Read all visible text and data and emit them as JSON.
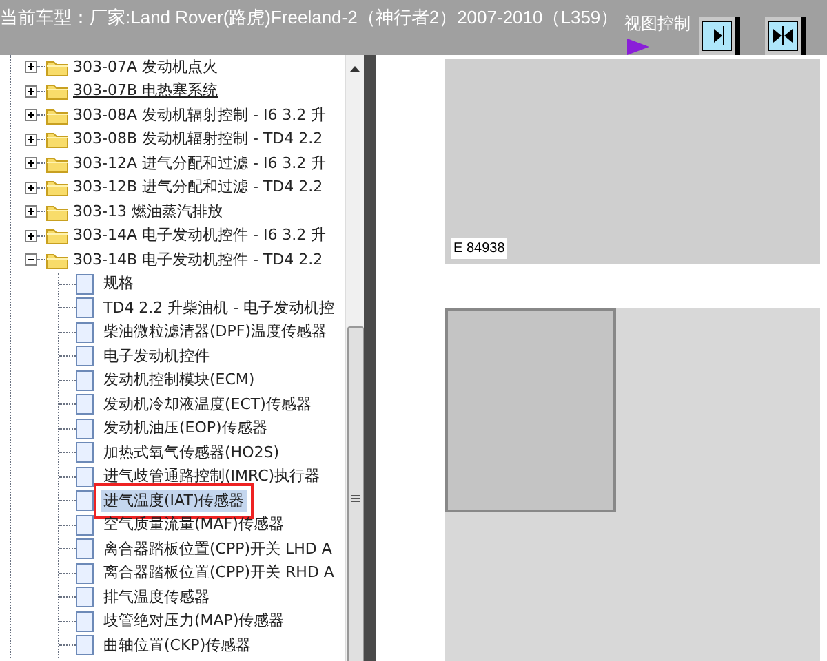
{
  "header": {
    "title": "当前车型：厂家:Land Rover(路虎)Freeland-2（神行者2）2007-2010（L359）",
    "view_control_label": "视图控制",
    "buttons": [
      {
        "kind": "expand"
      },
      {
        "kind": "split"
      }
    ]
  },
  "tree": [
    {
      "label": "303-07A 发动机点火",
      "expanded": false,
      "hovered": false
    },
    {
      "label": "303-07B 电热塞系统",
      "expanded": false,
      "hovered": true
    },
    {
      "label": "303-08A 发动机辐射控制 - I6 3.2 升",
      "expanded": false,
      "hovered": false
    },
    {
      "label": "303-08B 发动机辐射控制 - TD4 2.2",
      "expanded": false,
      "hovered": false
    },
    {
      "label": "303-12A 进气分配和过滤 - I6 3.2 升",
      "expanded": false,
      "hovered": false
    },
    {
      "label": "303-12B 进气分配和过滤 - TD4 2.2",
      "expanded": false,
      "hovered": false
    },
    {
      "label": "303-13 燃油蒸汽排放",
      "expanded": false,
      "hovered": false
    },
    {
      "label": "303-14A 电子发动机控件 - I6 3.2 升",
      "expanded": false,
      "hovered": false
    },
    {
      "label": "303-14B 电子发动机控件 - TD4 2.2",
      "expanded": true,
      "hovered": false,
      "children": [
        {
          "label": "规格",
          "selected": false
        },
        {
          "label": "TD4 2.2 升柴油机 - 电子发动机控",
          "selected": false
        },
        {
          "label": "柴油微粒滤清器(DPF)温度传感器",
          "selected": false
        },
        {
          "label": "电子发动机控件",
          "selected": false
        },
        {
          "label": "发动机控制模块(ECM)",
          "selected": false
        },
        {
          "label": "发动机冷却液温度(ECT)传感器",
          "selected": false
        },
        {
          "label": "发动机油压(EOP)传感器",
          "selected": false
        },
        {
          "label": "加热式氧气传感器(HO2S)",
          "selected": false
        },
        {
          "label": "进气歧管通路控制(IMRC)执行器",
          "selected": false
        },
        {
          "label": "进气温度(IAT)传感器",
          "selected": true
        },
        {
          "label": "空气质量流量(MAF)传感器",
          "selected": false
        },
        {
          "label": "离合器踏板位置(CPP)开关 LHD A",
          "selected": false
        },
        {
          "label": "离合器踏板位置(CPP)开关 RHD A",
          "selected": false
        },
        {
          "label": "排气温度传感器",
          "selected": false
        },
        {
          "label": "歧管绝对压力(MAP)传感器",
          "selected": false
        },
        {
          "label": "曲轴位置(CKP)传感器",
          "selected": false
        }
      ]
    }
  ],
  "figures": [
    {
      "label": "E 84938",
      "inset": false
    },
    {
      "inset": true
    }
  ]
}
